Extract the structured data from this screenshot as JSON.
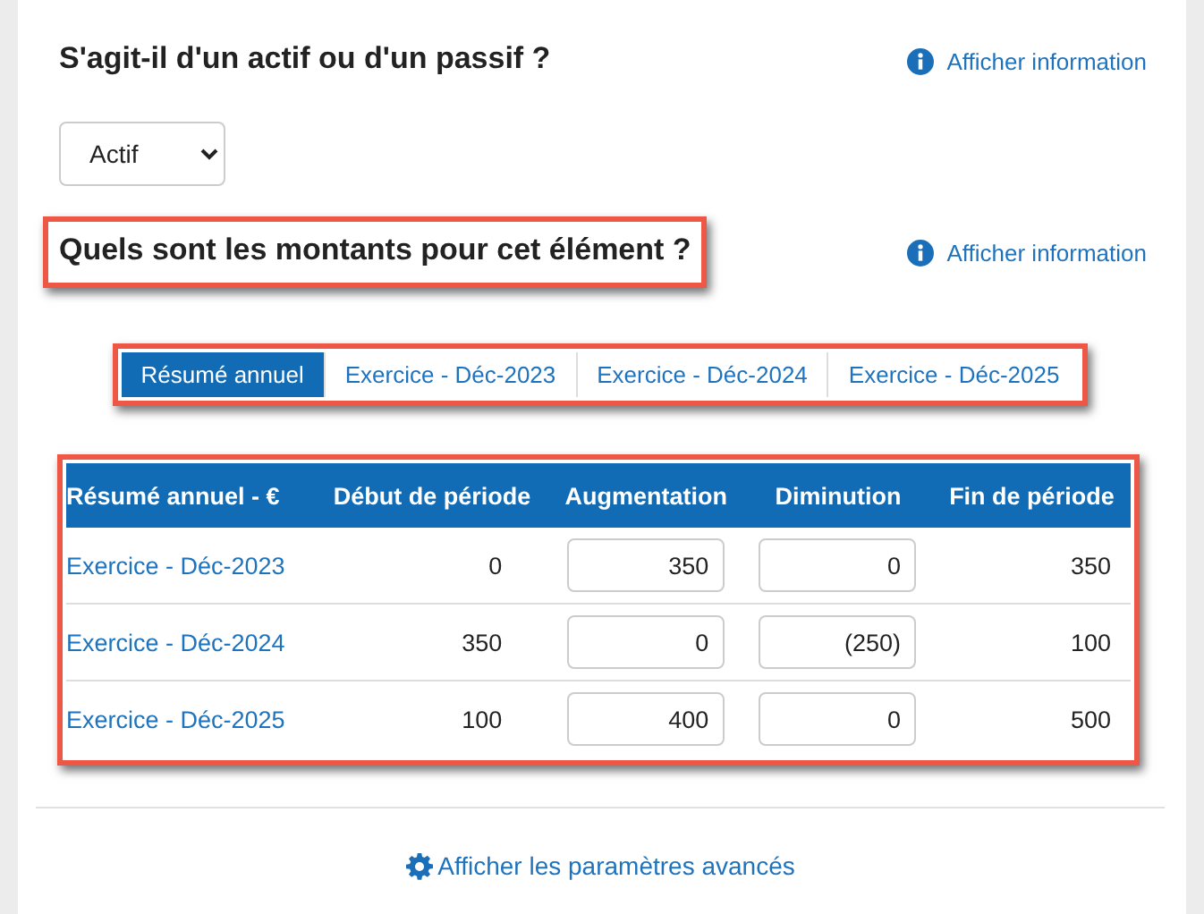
{
  "asset_question": {
    "title": "S'agit-il d'un actif ou d'un passif ?",
    "info_link": "Afficher information",
    "highlighted": false
  },
  "type_select": {
    "value": "Actif"
  },
  "amounts_question": {
    "title": "Quels sont les montants pour cet élément ?",
    "info_link": "Afficher information",
    "highlighted": true
  },
  "tabs": {
    "highlighted": true,
    "items": [
      {
        "label": "Résumé annuel",
        "selected": true
      },
      {
        "label": "Exercice - Déc-2023",
        "selected": false
      },
      {
        "label": "Exercice - Déc-2024",
        "selected": false
      },
      {
        "label": "Exercice - Déc-2025",
        "selected": false
      }
    ]
  },
  "table": {
    "highlighted": true,
    "columns": [
      "Résumé annuel - €",
      "Début de période",
      "Augmentation",
      "Diminution",
      "Fin de période"
    ],
    "rows": [
      {
        "period": "Exercice - Déc-2023",
        "start": "0",
        "increase": "350",
        "decrease": "0",
        "end": "350"
      },
      {
        "period": "Exercice - Déc-2024",
        "start": "350",
        "increase": "0",
        "decrease": "(250)",
        "end": "100"
      },
      {
        "period": "Exercice - Déc-2025",
        "start": "100",
        "increase": "400",
        "decrease": "0",
        "end": "500"
      }
    ]
  },
  "advanced_link": "Afficher les paramètres avancés"
}
